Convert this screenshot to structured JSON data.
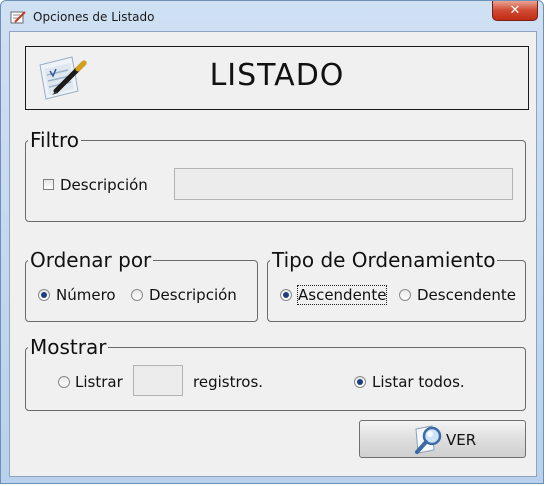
{
  "window": {
    "title": "Opciones de Listado",
    "close_label": "✕"
  },
  "header": {
    "title": "LISTADO"
  },
  "filtro": {
    "legend": "Filtro",
    "descripcion_label": "Descripción",
    "descripcion_checked": false,
    "descripcion_value": ""
  },
  "ordenar": {
    "legend": "Ordenar por",
    "options": [
      "Número",
      "Descripción"
    ],
    "selected": "Número"
  },
  "tipo": {
    "legend": "Tipo de Ordenamiento",
    "options": [
      "Ascendente",
      "Descendente"
    ],
    "selected": "Ascendente"
  },
  "mostrar": {
    "legend": "Mostrar",
    "listrar_label": "Listrar",
    "count_value": "",
    "registros_label": "registros.",
    "listar_todos_label": "Listar todos.",
    "selected": "Listar todos."
  },
  "actions": {
    "ver_label": "VER"
  }
}
